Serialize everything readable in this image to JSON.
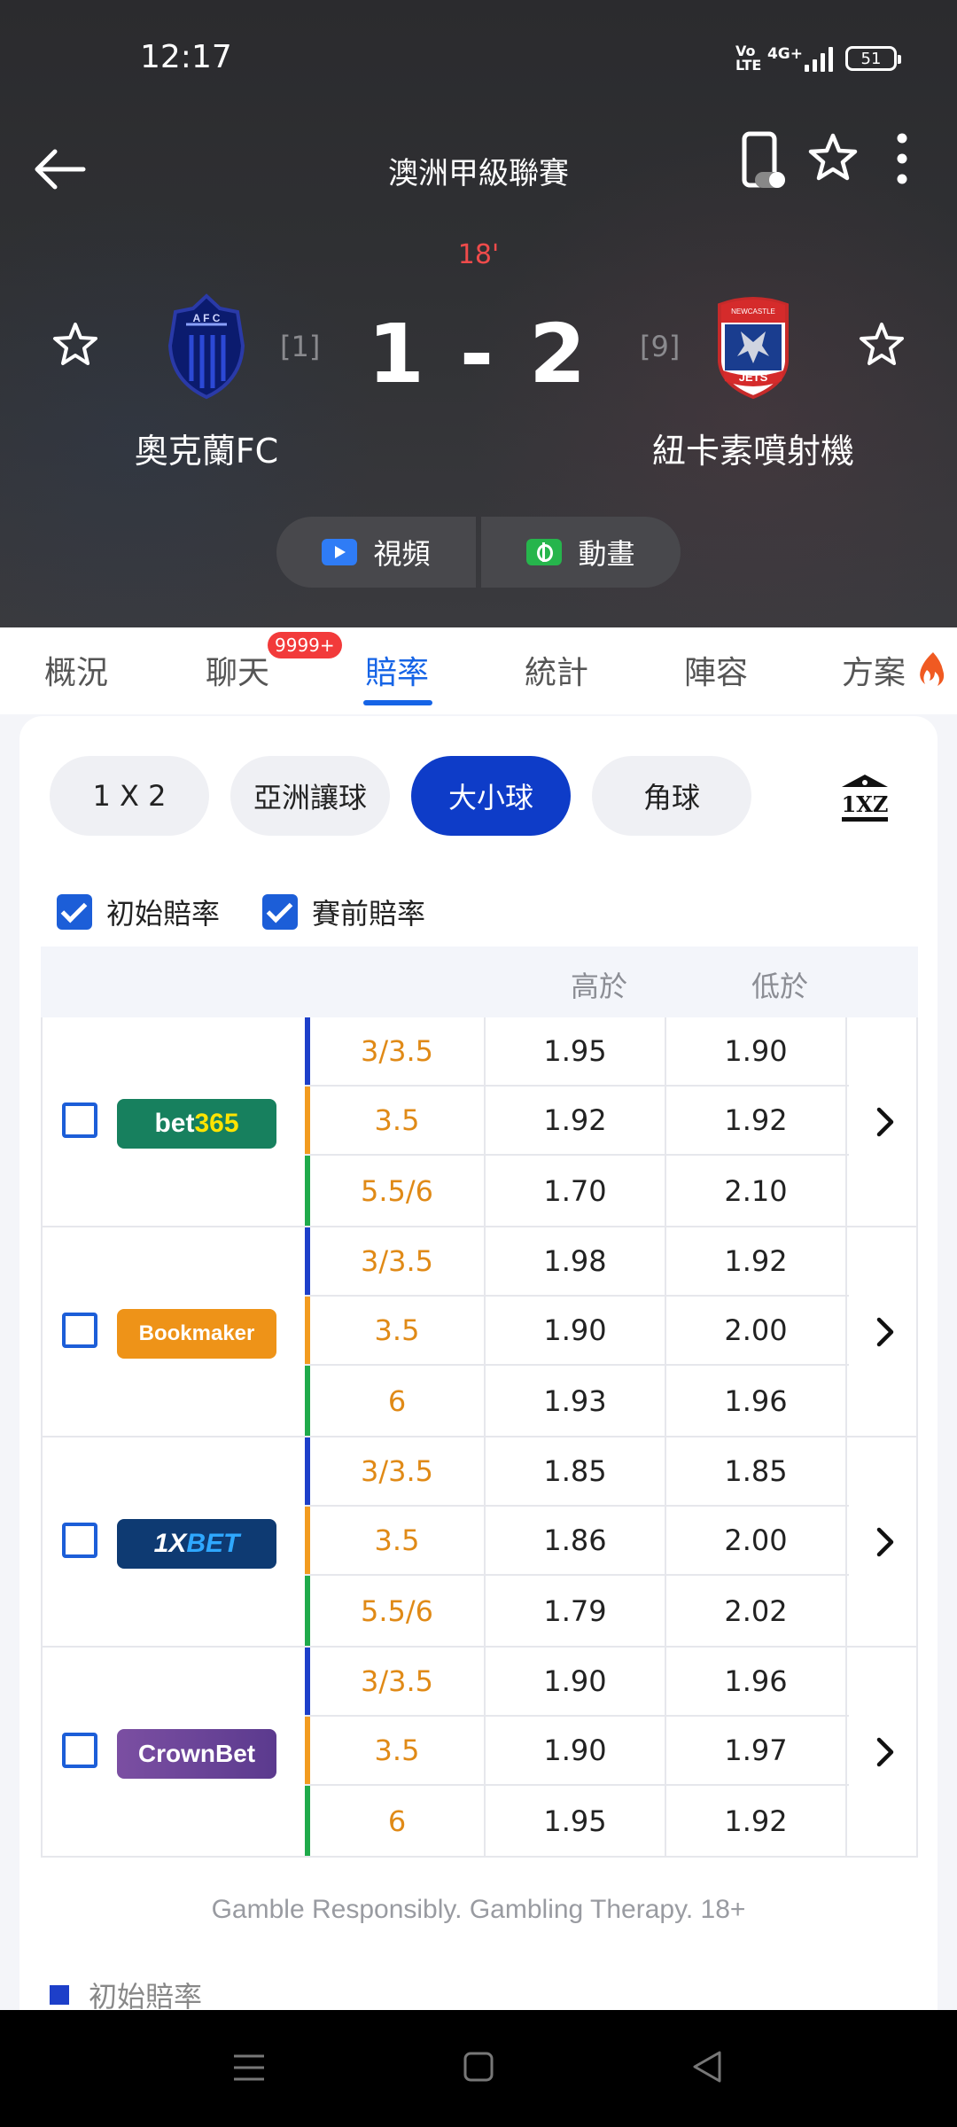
{
  "status_bar": {
    "time": "12:17",
    "volte": "Vo LTE",
    "network": "4G+",
    "battery": "51"
  },
  "nav": {
    "league": "澳洲甲級聯賽"
  },
  "match": {
    "minute": "18'",
    "score": "1 - 2",
    "home": {
      "name": "奧克蘭FC",
      "rank": "[1]"
    },
    "away": {
      "name": "紐卡素噴射機",
      "rank": "[9]"
    }
  },
  "media": {
    "video_label": "視頻",
    "animation_label": "動畫"
  },
  "tabs": [
    {
      "label": "概況"
    },
    {
      "label": "聊天",
      "badge": "9999+"
    },
    {
      "label": "賠率"
    },
    {
      "label": "統計"
    },
    {
      "label": "陣容"
    },
    {
      "label": "方案"
    }
  ],
  "odds_types": [
    "1 X 2",
    "亞洲讓球",
    "大小球",
    "角球"
  ],
  "filters": {
    "opening": "初始賠率",
    "prematch": "賽前賠率"
  },
  "table": {
    "headers": {
      "over": "高於",
      "under": "低於"
    },
    "bookmakers": [
      {
        "name": "bet365",
        "rows": [
          {
            "line": "3/3.5",
            "over": "1.95",
            "under": "1.90"
          },
          {
            "line": "3.5",
            "over": "1.92",
            "under": "1.92"
          },
          {
            "line": "5.5/6",
            "over": "1.70",
            "under": "2.10"
          }
        ]
      },
      {
        "name": "Bookmaker",
        "rows": [
          {
            "line": "3/3.5",
            "over": "1.98",
            "under": "1.92"
          },
          {
            "line": "3.5",
            "over": "1.90",
            "under": "2.00"
          },
          {
            "line": "6",
            "over": "1.93",
            "under": "1.96"
          }
        ]
      },
      {
        "name": "1XBET",
        "rows": [
          {
            "line": "3/3.5",
            "over": "1.85",
            "under": "1.85"
          },
          {
            "line": "3.5",
            "over": "1.86",
            "under": "2.00"
          },
          {
            "line": "5.5/6",
            "over": "1.79",
            "under": "2.02"
          }
        ]
      },
      {
        "name": "CrownBet",
        "rows": [
          {
            "line": "3/3.5",
            "over": "1.90",
            "under": "1.96"
          },
          {
            "line": "3.5",
            "over": "1.90",
            "under": "1.97"
          },
          {
            "line": "6",
            "over": "1.95",
            "under": "1.92"
          }
        ]
      }
    ]
  },
  "disclaimer": "Gamble Responsibly. Gambling Therapy. 18+",
  "legend": {
    "opening": "初始賠率"
  },
  "colors": {
    "accent": "#1664e6",
    "active_pill": "#0e3cc8",
    "line_text": "#e08a17",
    "bar_opening": "#1d3fc9",
    "bar_prematch": "#f29b1f",
    "bar_live": "#1faa4a"
  }
}
